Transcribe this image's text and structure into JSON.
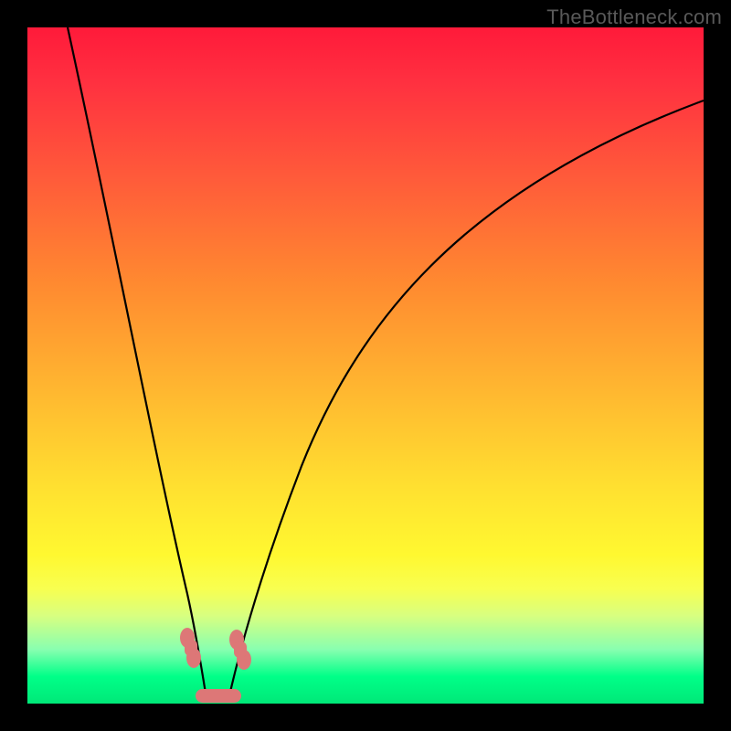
{
  "watermark": "TheBottleneck.com",
  "chart_data": {
    "type": "line",
    "title": "",
    "xlabel": "",
    "ylabel": "",
    "xlim": [
      0,
      100
    ],
    "ylim": [
      0,
      100
    ],
    "background_gradient": {
      "orientation": "vertical",
      "stops": [
        {
          "pos": 0,
          "color": "#ff1a3a"
        },
        {
          "pos": 50,
          "color": "#ffb830"
        },
        {
          "pos": 80,
          "color": "#fff830"
        },
        {
          "pos": 100,
          "color": "#00e878"
        }
      ]
    },
    "series": [
      {
        "name": "left-branch",
        "x": [
          6,
          10,
          14,
          18,
          21,
          23,
          24.5,
          25.5,
          26
        ],
        "values": [
          100,
          78,
          56,
          36,
          20,
          10,
          4,
          1.5,
          0
        ]
      },
      {
        "name": "right-branch",
        "x": [
          30,
          31,
          33,
          36,
          40,
          46,
          54,
          64,
          76,
          88,
          100
        ],
        "values": [
          0,
          2,
          8,
          18,
          30,
          44,
          58,
          70,
          79,
          85,
          89
        ]
      }
    ],
    "markers": [
      {
        "name": "left-dumbbell",
        "x": 24.0,
        "y": 7.0
      },
      {
        "name": "right-dumbbell",
        "x": 31.5,
        "y": 6.0
      },
      {
        "name": "bottom-capsule",
        "x": 28.0,
        "y": 0.8
      }
    ]
  }
}
